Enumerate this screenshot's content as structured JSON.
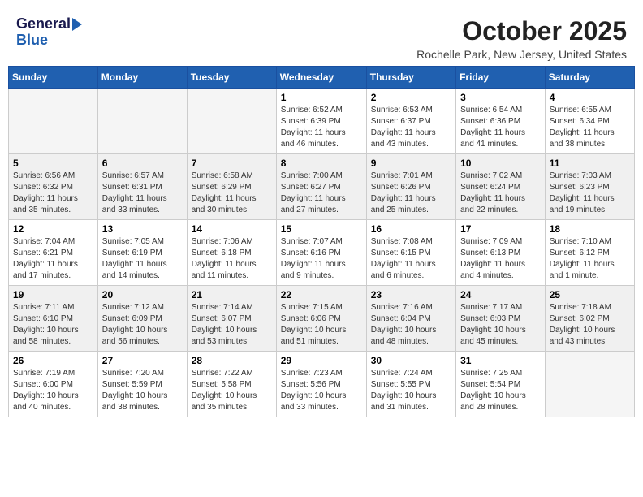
{
  "header": {
    "logo_line1": "General",
    "logo_line2": "Blue",
    "month": "October 2025",
    "location": "Rochelle Park, New Jersey, United States"
  },
  "weekdays": [
    "Sunday",
    "Monday",
    "Tuesday",
    "Wednesday",
    "Thursday",
    "Friday",
    "Saturday"
  ],
  "weeks": [
    [
      {
        "day": "",
        "info": ""
      },
      {
        "day": "",
        "info": ""
      },
      {
        "day": "",
        "info": ""
      },
      {
        "day": "1",
        "info": "Sunrise: 6:52 AM\nSunset: 6:39 PM\nDaylight: 11 hours\nand 46 minutes."
      },
      {
        "day": "2",
        "info": "Sunrise: 6:53 AM\nSunset: 6:37 PM\nDaylight: 11 hours\nand 43 minutes."
      },
      {
        "day": "3",
        "info": "Sunrise: 6:54 AM\nSunset: 6:36 PM\nDaylight: 11 hours\nand 41 minutes."
      },
      {
        "day": "4",
        "info": "Sunrise: 6:55 AM\nSunset: 6:34 PM\nDaylight: 11 hours\nand 38 minutes."
      }
    ],
    [
      {
        "day": "5",
        "info": "Sunrise: 6:56 AM\nSunset: 6:32 PM\nDaylight: 11 hours\nand 35 minutes."
      },
      {
        "day": "6",
        "info": "Sunrise: 6:57 AM\nSunset: 6:31 PM\nDaylight: 11 hours\nand 33 minutes."
      },
      {
        "day": "7",
        "info": "Sunrise: 6:58 AM\nSunset: 6:29 PM\nDaylight: 11 hours\nand 30 minutes."
      },
      {
        "day": "8",
        "info": "Sunrise: 7:00 AM\nSunset: 6:27 PM\nDaylight: 11 hours\nand 27 minutes."
      },
      {
        "day": "9",
        "info": "Sunrise: 7:01 AM\nSunset: 6:26 PM\nDaylight: 11 hours\nand 25 minutes."
      },
      {
        "day": "10",
        "info": "Sunrise: 7:02 AM\nSunset: 6:24 PM\nDaylight: 11 hours\nand 22 minutes."
      },
      {
        "day": "11",
        "info": "Sunrise: 7:03 AM\nSunset: 6:23 PM\nDaylight: 11 hours\nand 19 minutes."
      }
    ],
    [
      {
        "day": "12",
        "info": "Sunrise: 7:04 AM\nSunset: 6:21 PM\nDaylight: 11 hours\nand 17 minutes."
      },
      {
        "day": "13",
        "info": "Sunrise: 7:05 AM\nSunset: 6:19 PM\nDaylight: 11 hours\nand 14 minutes."
      },
      {
        "day": "14",
        "info": "Sunrise: 7:06 AM\nSunset: 6:18 PM\nDaylight: 11 hours\nand 11 minutes."
      },
      {
        "day": "15",
        "info": "Sunrise: 7:07 AM\nSunset: 6:16 PM\nDaylight: 11 hours\nand 9 minutes."
      },
      {
        "day": "16",
        "info": "Sunrise: 7:08 AM\nSunset: 6:15 PM\nDaylight: 11 hours\nand 6 minutes."
      },
      {
        "day": "17",
        "info": "Sunrise: 7:09 AM\nSunset: 6:13 PM\nDaylight: 11 hours\nand 4 minutes."
      },
      {
        "day": "18",
        "info": "Sunrise: 7:10 AM\nSunset: 6:12 PM\nDaylight: 11 hours\nand 1 minute."
      }
    ],
    [
      {
        "day": "19",
        "info": "Sunrise: 7:11 AM\nSunset: 6:10 PM\nDaylight: 10 hours\nand 58 minutes."
      },
      {
        "day": "20",
        "info": "Sunrise: 7:12 AM\nSunset: 6:09 PM\nDaylight: 10 hours\nand 56 minutes."
      },
      {
        "day": "21",
        "info": "Sunrise: 7:14 AM\nSunset: 6:07 PM\nDaylight: 10 hours\nand 53 minutes."
      },
      {
        "day": "22",
        "info": "Sunrise: 7:15 AM\nSunset: 6:06 PM\nDaylight: 10 hours\nand 51 minutes."
      },
      {
        "day": "23",
        "info": "Sunrise: 7:16 AM\nSunset: 6:04 PM\nDaylight: 10 hours\nand 48 minutes."
      },
      {
        "day": "24",
        "info": "Sunrise: 7:17 AM\nSunset: 6:03 PM\nDaylight: 10 hours\nand 45 minutes."
      },
      {
        "day": "25",
        "info": "Sunrise: 7:18 AM\nSunset: 6:02 PM\nDaylight: 10 hours\nand 43 minutes."
      }
    ],
    [
      {
        "day": "26",
        "info": "Sunrise: 7:19 AM\nSunset: 6:00 PM\nDaylight: 10 hours\nand 40 minutes."
      },
      {
        "day": "27",
        "info": "Sunrise: 7:20 AM\nSunset: 5:59 PM\nDaylight: 10 hours\nand 38 minutes."
      },
      {
        "day": "28",
        "info": "Sunrise: 7:22 AM\nSunset: 5:58 PM\nDaylight: 10 hours\nand 35 minutes."
      },
      {
        "day": "29",
        "info": "Sunrise: 7:23 AM\nSunset: 5:56 PM\nDaylight: 10 hours\nand 33 minutes."
      },
      {
        "day": "30",
        "info": "Sunrise: 7:24 AM\nSunset: 5:55 PM\nDaylight: 10 hours\nand 31 minutes."
      },
      {
        "day": "31",
        "info": "Sunrise: 7:25 AM\nSunset: 5:54 PM\nDaylight: 10 hours\nand 28 minutes."
      },
      {
        "day": "",
        "info": ""
      }
    ]
  ]
}
